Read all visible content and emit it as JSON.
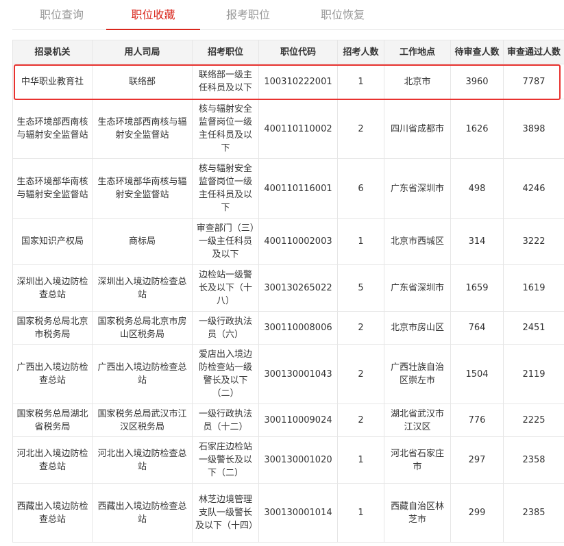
{
  "tabs": [
    {
      "label": "职位查询",
      "active": false
    },
    {
      "label": "职位收藏",
      "active": true
    },
    {
      "label": "报考职位",
      "active": false
    },
    {
      "label": "职位恢复",
      "active": false
    }
  ],
  "table": {
    "headers": [
      "招录机关",
      "用人司局",
      "招考职位",
      "职位代码",
      "招考人数",
      "工作地点",
      "待审查人数",
      "审查通过人数"
    ],
    "rows": [
      [
        "中华职业教育社",
        "联络部",
        "联络部一级主任科员及以下",
        "100310222001",
        "1",
        "北京市",
        "3960",
        "7787"
      ],
      [
        "生态环境部西南核与辐射安全监督站",
        "生态环境部西南核与辐射安全监督站",
        "核与辐射安全监督岗位一级主任科员及以下",
        "400110110002",
        "2",
        "四川省成都市",
        "1626",
        "3898"
      ],
      [
        "生态环境部华南核与辐射安全监督站",
        "生态环境部华南核与辐射安全监督站",
        "核与辐射安全监督岗位一级主任科员及以下",
        "400110116001",
        "6",
        "广东省深圳市",
        "498",
        "4246"
      ],
      [
        "国家知识产权局",
        "商标局",
        "审查部门（三）一级主任科员及以下",
        "400110002003",
        "1",
        "北京市西城区",
        "314",
        "3222"
      ],
      [
        "深圳出入境边防检查总站",
        "深圳出入境边防检查总站",
        "边检站一级警长及以下（十八）",
        "300130265022",
        "5",
        "广东省深圳市",
        "1659",
        "1619"
      ],
      [
        "国家税务总局北京市税务局",
        "国家税务总局北京市房山区税务局",
        "一级行政执法员（六）",
        "300110008006",
        "2",
        "北京市房山区",
        "764",
        "2451"
      ],
      [
        "广西出入境边防检查总站",
        "广西出入境边防检查总站",
        "爱店出入境边防检查站一级警长及以下（二）",
        "300130001043",
        "2",
        "广西壮族自治区崇左市",
        "1504",
        "2119"
      ],
      [
        "国家税务总局湖北省税务局",
        "国家税务总局武汉市江汉区税务局",
        "一级行政执法员（十二）",
        "300110009024",
        "2",
        "湖北省武汉市江汉区",
        "776",
        "2225"
      ],
      [
        "河北出入境边防检查总站",
        "河北出入境边防检查总站",
        "石家庄边检站一级警长及以下（二）",
        "300130001020",
        "1",
        "河北省石家庄市",
        "297",
        "2358"
      ],
      [
        "西藏出入境边防检查总站",
        "西藏出入境边防检查总站",
        "林芝边境管理支队一级警长及以下（十四）",
        "300130001014",
        "1",
        "西藏自治区林芝市",
        "299",
        "2385"
      ]
    ],
    "highlighted_row": 0
  },
  "colors": {
    "accent": "#d9261c",
    "highlight_border": "#e8322f",
    "header_bg": "#f4f4f4",
    "border": "#e6e6e6"
  }
}
